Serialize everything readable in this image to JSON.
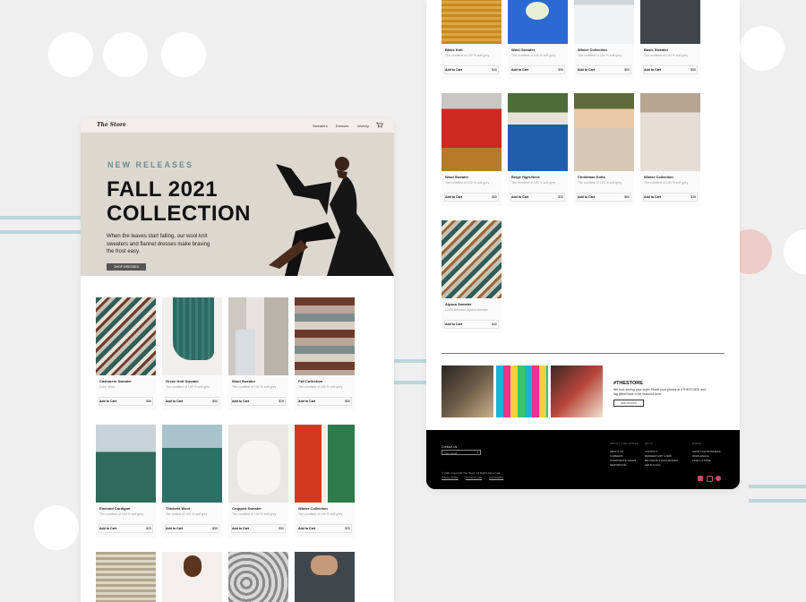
{
  "left_page": {
    "nav": {
      "logo": "The Store",
      "links": [
        "Sweaters",
        "Dresses",
        "Jewelry"
      ]
    },
    "hero": {
      "eyebrow": "NEW RELEASES",
      "headline_line1": "FALL 2021",
      "headline_line2": "COLLECTION",
      "body": "When the leaves start falling, our wool knit sweaters and flannel dresses make braving the frost easy.",
      "cta": "SHOP DRESSES"
    },
    "products": [
      {
        "name": "Cashmere Sweater",
        "desc": "Color Wool",
        "add": "Add to Cart",
        "price": "$56"
      },
      {
        "name": "Green Knit Sweater",
        "desc": "The comfiest of 100 % soft grey",
        "add": "Add to Cart",
        "price": "$60"
      },
      {
        "name": "Wool Sweater",
        "desc": "The comfiest of 100 % soft grey",
        "add": "Add to Cart",
        "price": "$25"
      },
      {
        "name": "Fall Collection",
        "desc": "The comfiest of 100 % soft grey",
        "add": "Add to Cart",
        "price": "$50"
      },
      {
        "name": "Emerald Cardigan",
        "desc": "The comfiest of 100 % soft grey",
        "add": "Add to Cart",
        "price": "$25"
      },
      {
        "name": "Thickest Wool",
        "desc": "The softest of 100 % soft grey",
        "add": "Add to Cart",
        "price": "$55"
      },
      {
        "name": "Cropped Sweater",
        "desc": "The comfiest of 100 % soft grey",
        "add": "Add to Cart",
        "price": "$50"
      },
      {
        "name": "Winter Collection",
        "desc": "The comfiest of 100 % soft grey",
        "add": "Add to Cart",
        "price": "$25"
      }
    ]
  },
  "right_page": {
    "products": [
      {
        "name": "Basic Knit",
        "desc": "The comfiest of 100 % soft grey",
        "add": "Add to Cart",
        "price": "$40"
      },
      {
        "name": "Wool Sweater",
        "desc": "The comfiest of 100 % soft grey",
        "add": "Add to Cart",
        "price": "$55"
      },
      {
        "name": "Winter Collection",
        "desc": "The comfiest of 100 % soft grey",
        "add": "Add to Cart",
        "price": "$60"
      },
      {
        "name": "Basic Sweater",
        "desc": "The comfiest of 100 % soft grey",
        "add": "Add to Cart",
        "price": "$55"
      },
      {
        "name": "Wool Sweater",
        "desc": "The comfiest of 100 % soft grey",
        "add": "Add to Cart",
        "price": "$50"
      },
      {
        "name": "Beige High-Neck",
        "desc": "The comfiest of 100 % soft grey",
        "add": "Add to Cart",
        "price": "$30"
      },
      {
        "name": "Christmas Knits",
        "desc": "The comfiest of 100 % soft grey",
        "add": "Add to Cart",
        "price": "$60"
      },
      {
        "name": "Winter Collection",
        "desc": "The comfiest of 100 % soft grey",
        "add": "Add to Cart",
        "price": "$35"
      },
      {
        "name": "Alpaca Sweater",
        "desc": "100% Genuine Alpaca sweater",
        "add": "Add to Cart",
        "price": "$40"
      }
    ],
    "social": {
      "title": "#THESTORE",
      "text_line1": "We love seeing your style! Share your photos at #THESTORE and",
      "text_line2": "tag @theStore to be featured here.",
      "button": "ADD PHOTO"
    },
    "footer": {
      "contact_label": "Contact Us",
      "email_placeholder": "Your email",
      "copyright": "© 2021 Copyright The Store. All Rights Reserved.",
      "legal": [
        "Privacy Policy",
        "Terms Of Use",
        "Accessibility"
      ],
      "col1_title": "ABOUT THE STORE",
      "col1": [
        "ABOUT US",
        "CAREERS",
        "CORPORATE SALES",
        "NEWSROOM"
      ],
      "col2_title": "HELP",
      "col2": [
        "CONTACT",
        "REDEEM GIFT CARD",
        "RETURNS & EXCHANGES",
        "HELP & FAQ"
      ],
      "col3_title": "MORE",
      "col3": [
        "SHOP FOR BUSINESS",
        "WHOLESALE",
        "FIND A STORE"
      ]
    }
  }
}
